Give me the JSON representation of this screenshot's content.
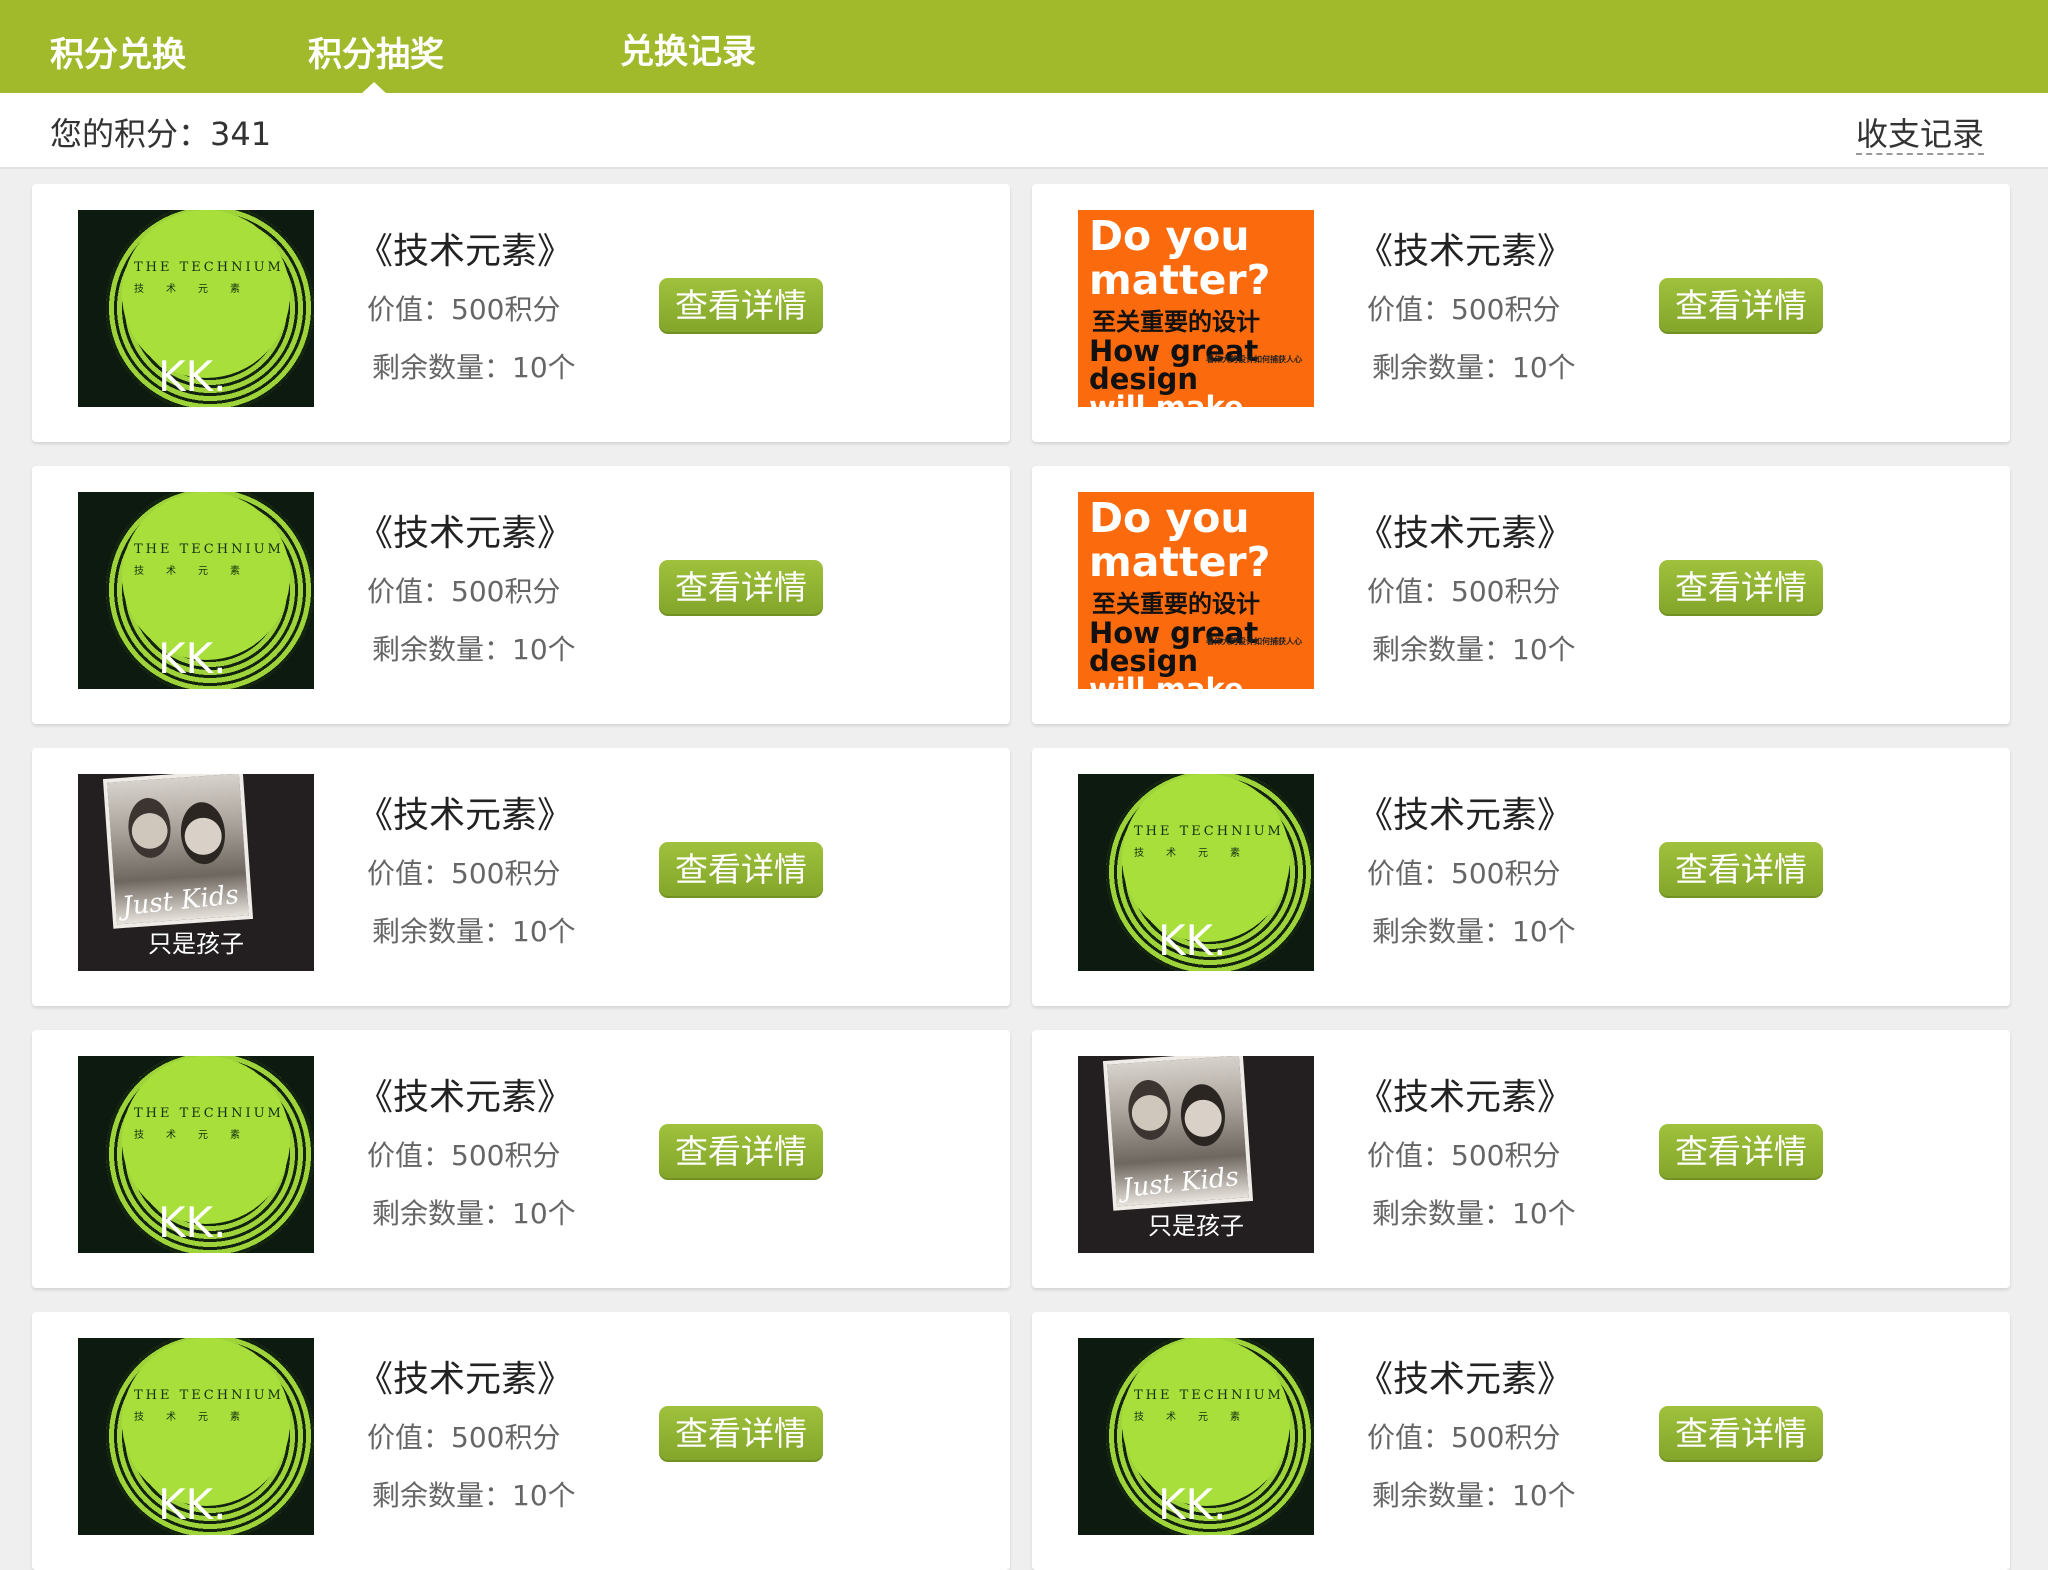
{
  "tabs": [
    {
      "label": "积分兑换"
    },
    {
      "label": "积分抽奖"
    },
    {
      "label": "兑换记录"
    }
  ],
  "colors": {
    "accent": "#a0ba2b",
    "button": "#8db134",
    "background": "#efefef"
  },
  "points": {
    "label": "您的积分：",
    "value": "341"
  },
  "history_link": "收支记录",
  "cover_text": {
    "technium_title": "THE TECHNIUM",
    "technium_sub": "技术元素",
    "technium_mark": "KK.",
    "design_lines": [
      "Do you",
      "matter?",
      "至关重要的设计",
      "How great",
      "design",
      "will make"
    ],
    "design_small": "看伟大的设计如何捕获人心",
    "kids_sig": "Just Kids",
    "kids_cn": "只是孩子"
  },
  "items": [
    {
      "cover": "technium",
      "title": "《技术元素》",
      "value": "价值：500积分",
      "stock": "剩余数量：10个",
      "button": "查看详情"
    },
    {
      "cover": "design",
      "title": "《技术元素》",
      "value": "价值：500积分",
      "stock": "剩余数量：10个",
      "button": "查看详情"
    },
    {
      "cover": "technium",
      "title": "《技术元素》",
      "value": "价值：500积分",
      "stock": "剩余数量：10个",
      "button": "查看详情"
    },
    {
      "cover": "design",
      "title": "《技术元素》",
      "value": "价值：500积分",
      "stock": "剩余数量：10个",
      "button": "查看详情"
    },
    {
      "cover": "kids",
      "title": "《技术元素》",
      "value": "价值：500积分",
      "stock": "剩余数量：10个",
      "button": "查看详情"
    },
    {
      "cover": "technium",
      "title": "《技术元素》",
      "value": "价值：500积分",
      "stock": "剩余数量：10个",
      "button": "查看详情"
    },
    {
      "cover": "technium",
      "title": "《技术元素》",
      "value": "价值：500积分",
      "stock": "剩余数量：10个",
      "button": "查看详情"
    },
    {
      "cover": "kids",
      "title": "《技术元素》",
      "value": "价值：500积分",
      "stock": "剩余数量：10个",
      "button": "查看详情"
    },
    {
      "cover": "technium",
      "title": "《技术元素》",
      "value": "价值：500积分",
      "stock": "剩余数量：10个",
      "button": "查看详情"
    },
    {
      "cover": "technium",
      "title": "《技术元素》",
      "value": "价值：500积分",
      "stock": "剩余数量：10个",
      "button": "查看详情"
    }
  ]
}
